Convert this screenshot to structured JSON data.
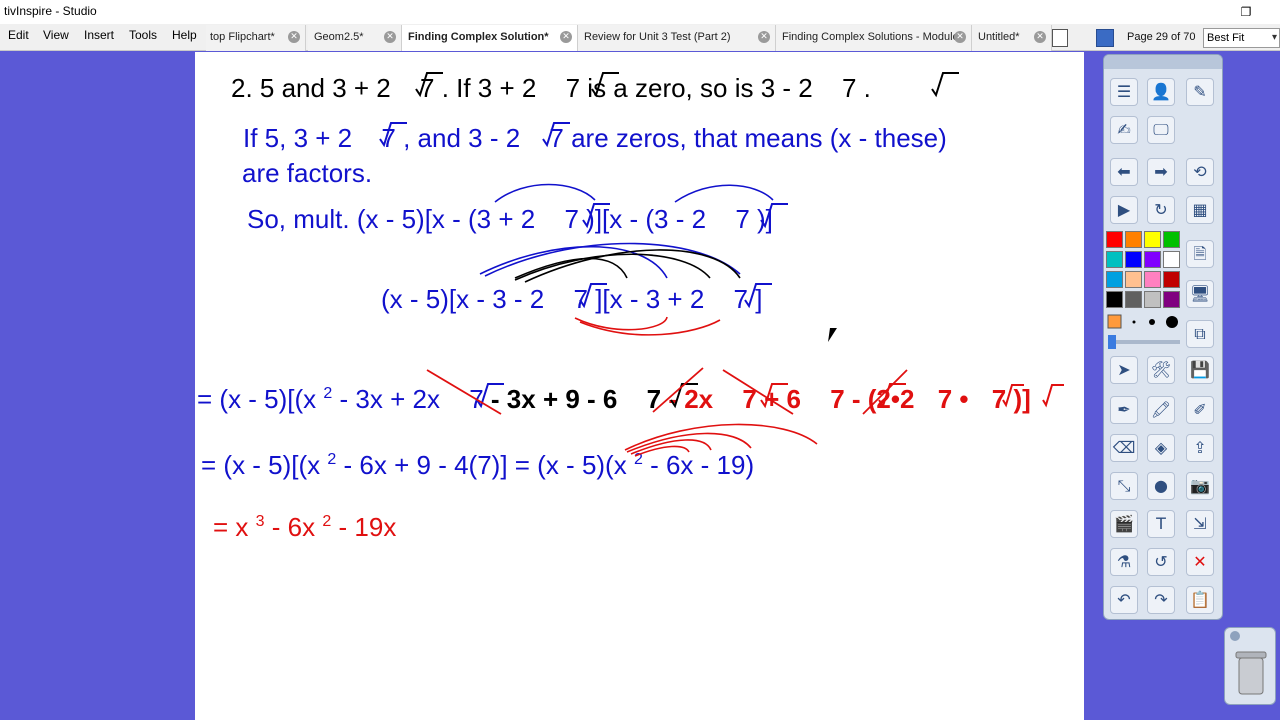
{
  "window": {
    "title": "tivInspire - Studio",
    "restore_glyph": "❐"
  },
  "menu": [
    "Edit",
    "View",
    "Insert",
    "Tools",
    "Help"
  ],
  "tabs": [
    {
      "label": "top Flipchart*",
      "active": false
    },
    {
      "label": "Geom2.5*",
      "active": false
    },
    {
      "label": "Finding Complex Solution*",
      "active": true
    },
    {
      "label": "Review for Unit 3 Test (Part 2)",
      "active": false
    },
    {
      "label": "Finding Complex Solutions - Module",
      "active": false
    },
    {
      "label": "Untitled*",
      "active": false
    }
  ],
  "tab_close_glyph": "✕",
  "page_counter": "Page 29 of 70",
  "zoom": {
    "value": "Best Fit",
    "arrow": "▾"
  },
  "flipchart": {
    "line1": [
      "2. 5 and 3 + 2",
      "7",
      " .  If 3 + 2",
      "7",
      "  is a zero,  so is  3 - 2",
      "7",
      "."
    ],
    "line2": [
      "If 5,  3 + 2",
      "7",
      ", and 3 - 2",
      "7",
      " are zeros, that means (x - these)"
    ],
    "line3": "are factors.",
    "line4": [
      "So, mult.  (x - 5)[x - (3 + 2",
      "7",
      ")][x - (3 - 2",
      "7",
      ")]"
    ],
    "line5": [
      "(x - 5)[x - 3 - 2",
      "7",
      "][x - 3 + 2",
      "7",
      "]"
    ],
    "line6": {
      "blue": [
        "= (x - 5)[(x",
        "2",
        " - 3x + 2x",
        "7"
      ],
      "black": [
        " - 3x + 9 - 6",
        "7"
      ],
      "red": [
        "  - 2x",
        "7",
        "  + 6",
        "7",
        "  -  (2•2 ",
        "7",
        "•",
        "7",
        ")]"
      ]
    },
    "line7": [
      "= (x - 5)[(x",
      "2",
      " - 6x + 9 - 4(7)]  =  (x - 5)(x",
      "2",
      " - 6x - 19)"
    ],
    "line8": [
      "= x",
      "3",
      " - 6x",
      "2",
      " - 19x"
    ]
  },
  "colors": {
    "background": "#5b59d6",
    "ink_blue": "#1111cc",
    "ink_red": "#e01010",
    "ink_black": "#000000"
  },
  "toolbox": {
    "buttons": [
      "main-menu-icon",
      "user-profile-icon",
      "browser-icon",
      "handwriting-icon",
      "desktop-annotate-icon",
      "previous-page-icon",
      "next-page-icon",
      "reset-page-icon",
      "play-icon",
      "refresh-icon",
      "calculator-icon",
      "page-icon",
      "desktop-tools-icon",
      "copy-icon",
      "select-icon",
      "tools-icon",
      "save-icon",
      "pen-icon",
      "highlighter-icon",
      "edit-icon",
      "eraser-icon",
      "fill-icon",
      "share-icon",
      "connector-icon",
      "shape-icon",
      "camera-icon",
      "media-icon",
      "text-icon",
      "export-icon",
      "magic-ink-icon",
      "revert-icon",
      "clear-icon",
      "undo-icon",
      "redo-icon",
      "paste-icon"
    ],
    "swatches": [
      "#ff0000",
      "#ff8000",
      "#ffff00",
      "#00c000",
      "#00c0c0",
      "#0000ff",
      "#8000ff",
      "#ffffff",
      "#00a0e0",
      "#ffc090",
      "#ff80c0",
      "#c00000",
      "#000000",
      "#606060",
      "#c0c0c0",
      "#800080"
    ]
  }
}
